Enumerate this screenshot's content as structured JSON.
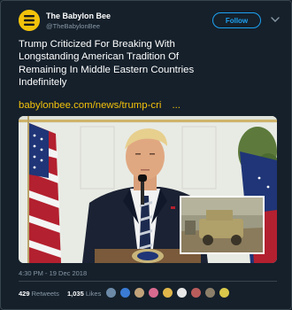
{
  "author": {
    "name": "The Babylon Bee",
    "handle": "@TheBabylonBee",
    "avatar_icon": "babylon-bee-logo",
    "avatar_color": "#f3c20b"
  },
  "follow_label": "Follow",
  "tweet": {
    "lines": [
      "Trump Criticized For Breaking With",
      "Longstanding American Tradition Of",
      "Remaining In Middle Eastern Countries",
      "Indefinitely"
    ],
    "link": "babylonbee.com/news/trump-cri",
    "link_ellipsis": "...",
    "link_color": "#f3c20b"
  },
  "media": {
    "image_icon": "press-conference-photo",
    "inset_icon": "military-vehicle-photo"
  },
  "timestamp": "4:30 PM - 19 Dec 2018",
  "stats": {
    "retweets_count": "429",
    "retweets_label": "Retweets",
    "likes_count": "1,035",
    "likes_label": "Likes"
  },
  "likers": [
    {
      "icon": "liker-avatar",
      "color": "#6c8aa8"
    },
    {
      "icon": "liker-avatar",
      "color": "#3a7bd5"
    },
    {
      "icon": "liker-avatar",
      "color": "#c2a37a"
    },
    {
      "icon": "liker-avatar",
      "color": "#d86a8f"
    },
    {
      "icon": "liker-avatar",
      "color": "#e0b64a"
    },
    {
      "icon": "liker-avatar",
      "color": "#e7e7e7"
    },
    {
      "icon": "liker-avatar",
      "color": "#b95c5c"
    },
    {
      "icon": "liker-avatar",
      "color": "#8c7f6a"
    },
    {
      "icon": "liker-avatar",
      "color": "#d9c84a"
    }
  ],
  "colors": {
    "background": "#15202b",
    "border": "#38444d",
    "accent": "#1da1f2",
    "muted": "#8899a6"
  }
}
